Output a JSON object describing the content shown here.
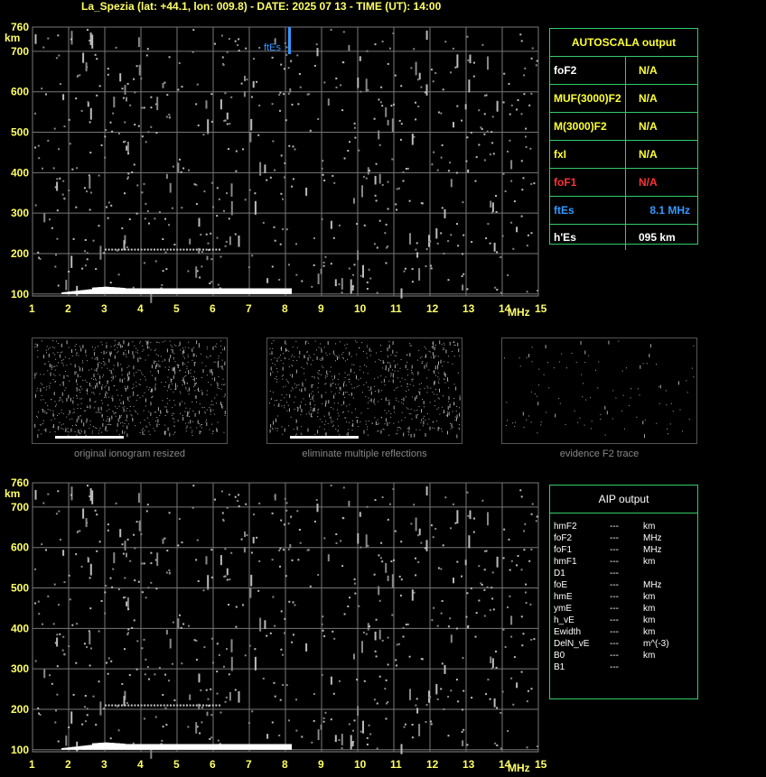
{
  "header": {
    "title": "La_Spezia (lat: +44.1, lon: 009.8) - DATE: 2025 07 13 - TIME (UT): 14:00"
  },
  "chart_data": [
    {
      "type": "scatter",
      "xlabel": "MHz",
      "ylabel": "km",
      "x_ticks": [
        "1",
        "2",
        "3",
        "4",
        "5",
        "6",
        "7",
        "8",
        "9",
        "10",
        "11",
        "12",
        "13",
        "14",
        "15"
      ],
      "y_ticks": [
        "100",
        "200",
        "300",
        "400",
        "500",
        "600",
        "700",
        "760"
      ],
      "xlim": [
        1,
        15
      ],
      "ylim": [
        95,
        760
      ],
      "annotation": {
        "label": "ftEs",
        "x": 8.1,
        "y": 720,
        "color": "#3399ff"
      }
    },
    {
      "type": "scatter",
      "xlabel": "MHz",
      "ylabel": "km",
      "x_ticks": [
        "1",
        "2",
        "3",
        "4",
        "5",
        "6",
        "7",
        "8",
        "9",
        "10",
        "11",
        "12",
        "13",
        "14",
        "15"
      ],
      "y_ticks": [
        "100",
        "200",
        "300",
        "400",
        "500",
        "600",
        "700",
        "760"
      ],
      "xlim": [
        1,
        15
      ],
      "ylim": [
        95,
        760
      ]
    }
  ],
  "autoscala": {
    "title": "AUTOSCALA output",
    "rows": [
      {
        "key": "foF2",
        "val": "N/A",
        "kcolor": "#ffffff",
        "vcolor": "#ffff33"
      },
      {
        "key": "MUF(3000)F2",
        "val": "N/A",
        "kcolor": "#ffff33",
        "vcolor": "#ffff33"
      },
      {
        "key": "M(3000)F2",
        "val": "N/A",
        "kcolor": "#ffff33",
        "vcolor": "#ffff33"
      },
      {
        "key": "fxI",
        "val": "N/A",
        "kcolor": "#ffff33",
        "vcolor": "#ffff33"
      },
      {
        "key": "foF1",
        "val": "N/A",
        "kcolor": "#ff3333",
        "vcolor": "#ff3333"
      },
      {
        "key": "ftEs",
        "val": "8.1  MHz",
        "kcolor": "#3399ff",
        "vcolor": "#3399ff"
      },
      {
        "key": "h'Es",
        "val": "095     km",
        "kcolor": "#ffffff",
        "vcolor": "#ffffff"
      }
    ]
  },
  "thumbnails": [
    {
      "caption": "original ionogram resized"
    },
    {
      "caption": "eliminate multiple reflections"
    },
    {
      "caption": "evidence F2 trace"
    }
  ],
  "aip": {
    "title": "AIP output",
    "rows": [
      [
        "hmF2",
        "---",
        "km"
      ],
      [
        "foF2",
        "---",
        "MHz"
      ],
      [
        "foF1",
        "---",
        "MHz"
      ],
      [
        "hmF1",
        "---",
        "km"
      ],
      [
        "D1",
        "---",
        ""
      ],
      [
        "foE",
        "---",
        "MHz"
      ],
      [
        "hmE",
        "---",
        "km"
      ],
      [
        "ymE",
        "---",
        "km"
      ],
      [
        "h_vE",
        "---",
        "km"
      ],
      [
        "Ewidth",
        "---",
        "km"
      ],
      [
        "DelN_vE",
        "---",
        "m^(-3)"
      ],
      [
        "B0",
        "---",
        "km"
      ],
      [
        "B1",
        "---",
        ""
      ]
    ]
  }
}
